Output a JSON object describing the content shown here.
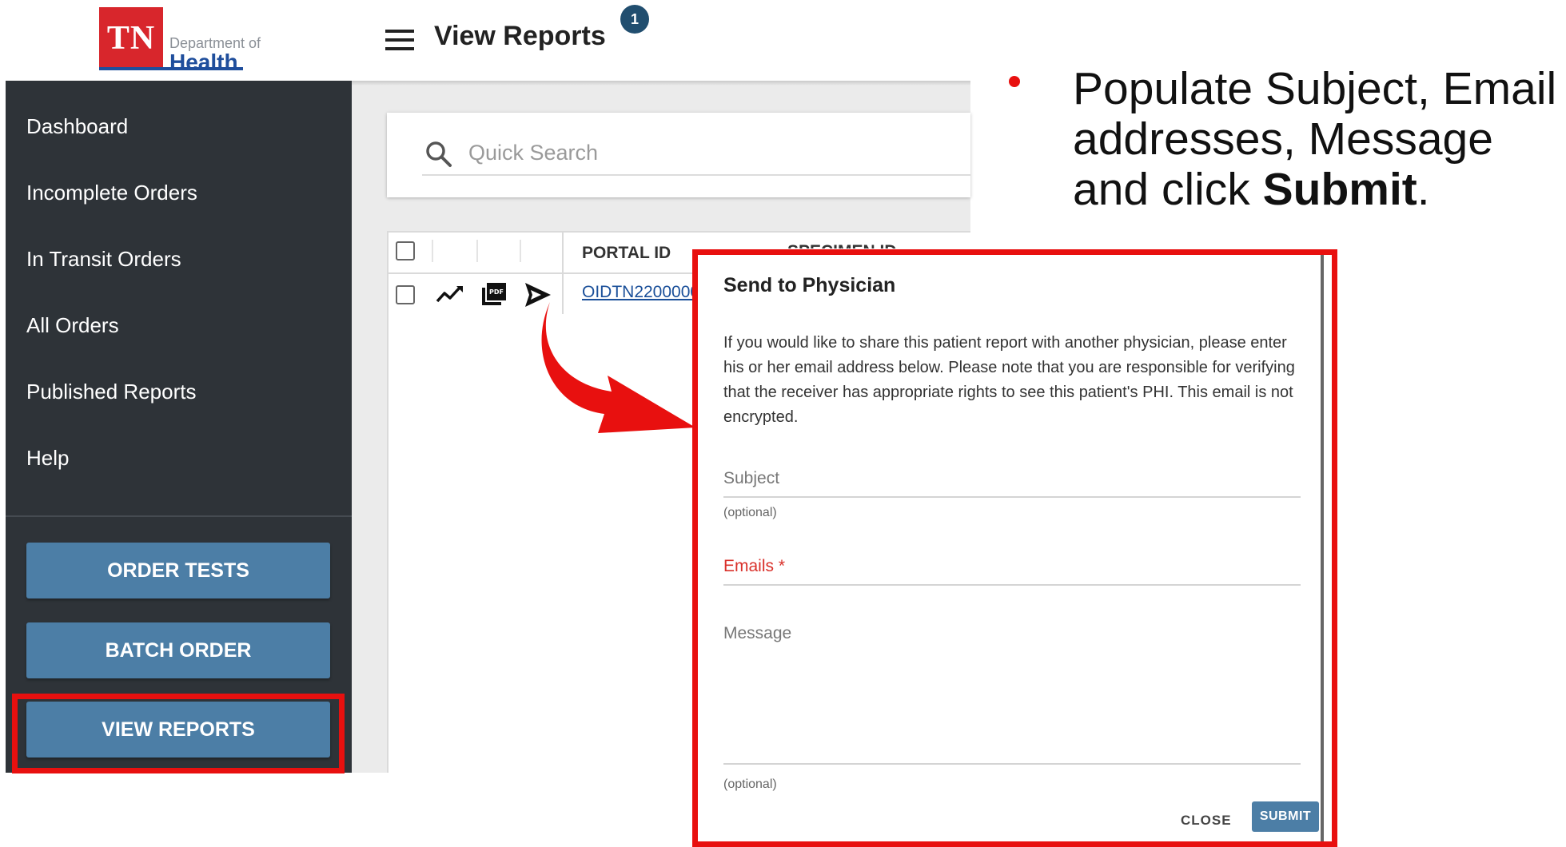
{
  "header": {
    "logo_mark": "TN",
    "logo_dept": "Department of",
    "logo_name": "Health",
    "page_title": "View Reports",
    "notification_count": "1"
  },
  "sidebar": {
    "items": [
      {
        "label": "Dashboard"
      },
      {
        "label": "Incomplete Orders"
      },
      {
        "label": "In Transit Orders"
      },
      {
        "label": "All Orders"
      },
      {
        "label": "Published Reports"
      },
      {
        "label": "Help"
      }
    ],
    "buttons": {
      "order_tests": "ORDER TESTS",
      "batch_order": "BATCH ORDER",
      "view_reports": "VIEW REPORTS"
    }
  },
  "search": {
    "placeholder": "Quick Search"
  },
  "table": {
    "columns": [
      "PORTAL ID",
      "SPECIMEN ID"
    ],
    "rows": [
      {
        "portal_id": "OIDTN2200000"
      }
    ]
  },
  "dialog": {
    "title": "Send to Physician",
    "body": "If you would like to share this patient report with another physician, please enter his or her email address below. Please note that you are responsible for verifying that the receiver has appropriate rights to see this patient's PHI. This email is not encrypted.",
    "subject_label": "Subject",
    "subject_helper": "(optional)",
    "emails_label": "Emails *",
    "message_label": "Message",
    "message_helper": "(optional)",
    "close_label": "CLOSE",
    "submit_label": "SUBMIT"
  },
  "instruction": {
    "text_before": "Populate Subject, Email addresses, Message and click ",
    "bold": "Submit",
    "text_after": "."
  },
  "colors": {
    "sidebar_bg": "#2e3338",
    "button_blue": "#4c7ea6",
    "highlight_red": "#e8100f",
    "brand_red": "#d8262c",
    "brand_blue": "#1f4e9c"
  }
}
